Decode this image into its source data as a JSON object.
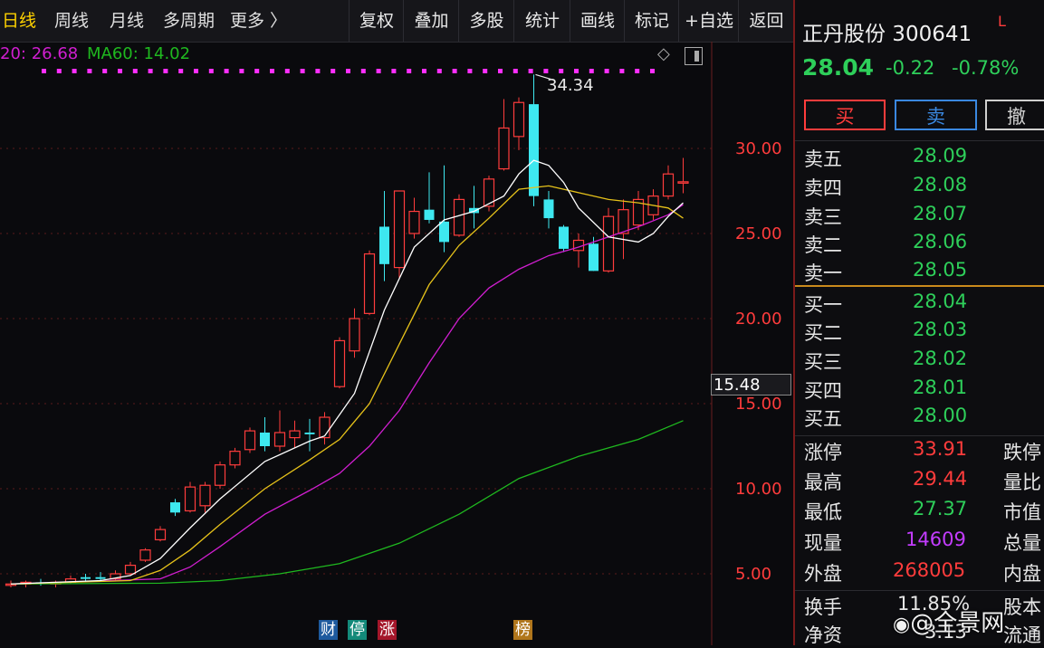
{
  "toolbar": {
    "tabs": [
      {
        "label": "日线",
        "active": true
      },
      {
        "label": "周线"
      },
      {
        "label": "月线"
      },
      {
        "label": "多周期"
      },
      {
        "label": "更多 〉"
      }
    ],
    "buttons": [
      "复权",
      "叠加",
      "多股",
      "统计",
      "画线",
      "标记",
      "+自选",
      "返回"
    ]
  },
  "ma_labels": {
    "ma20": "20: 26.68",
    "ma60": "MA60: 14.02"
  },
  "peak_label": "34.34",
  "price_axis": {
    "ticks": [
      "30.00",
      "25.00",
      "20.00",
      "15.00",
      "10.00",
      "5.00"
    ],
    "current_box": "15.48"
  },
  "event_markers": [
    "财",
    "停",
    "涨",
    "榜"
  ],
  "stock": {
    "name": "正丹股份 300641",
    "flag": "L",
    "price": "28.04",
    "change": "-0.22",
    "change_pct": "-0.78%"
  },
  "trade_buttons": {
    "buy": "买",
    "sell": "卖",
    "cancel": "撤"
  },
  "asks": [
    {
      "label": "卖五",
      "price": "28.09"
    },
    {
      "label": "卖四",
      "price": "28.08"
    },
    {
      "label": "卖三",
      "price": "28.07"
    },
    {
      "label": "卖二",
      "price": "28.06"
    },
    {
      "label": "卖一",
      "price": "28.05"
    }
  ],
  "bids": [
    {
      "label": "买一",
      "price": "28.04"
    },
    {
      "label": "买二",
      "price": "28.03"
    },
    {
      "label": "买三",
      "price": "28.02"
    },
    {
      "label": "买四",
      "price": "28.01"
    },
    {
      "label": "买五",
      "price": "28.00"
    }
  ],
  "stats": [
    {
      "label": "涨停",
      "value": "33.91",
      "label2": "跌停"
    },
    {
      "label": "最高",
      "value": "29.44",
      "label2": "量比"
    },
    {
      "label": "最低",
      "value": "27.37",
      "label2": "市值"
    },
    {
      "label": "现量",
      "value": "14609",
      "label2": "总量"
    },
    {
      "label": "外盘",
      "value": "268005",
      "label2": "内盘"
    }
  ],
  "extra": [
    {
      "label": "换手",
      "value": "11.85%",
      "label2": "股本"
    },
    {
      "label": "净资",
      "value": "3.13",
      "label2": "流通"
    }
  ],
  "watermark": "@全景网",
  "colors": {
    "up": "#ff3c3c",
    "down": "#3ee8f0",
    "ma5": "#ffffff",
    "ma10": "#e6c21a",
    "ma20": "#d01ed0",
    "ma60": "#1fb81f"
  },
  "chart_data": {
    "type": "candlestick",
    "ylim": [
      3,
      36
    ],
    "candles": [
      {
        "o": 4.4,
        "h": 4.6,
        "l": 4.2,
        "c": 4.4
      },
      {
        "o": 4.4,
        "h": 4.6,
        "l": 4.2,
        "c": 4.5
      },
      {
        "o": 4.5,
        "h": 4.7,
        "l": 4.3,
        "c": 4.4
      },
      {
        "o": 4.4,
        "h": 4.6,
        "l": 4.2,
        "c": 4.5
      },
      {
        "o": 4.5,
        "h": 4.9,
        "l": 4.4,
        "c": 4.7
      },
      {
        "o": 4.8,
        "h": 5.0,
        "l": 4.6,
        "c": 4.7
      },
      {
        "o": 4.8,
        "h": 5.1,
        "l": 4.6,
        "c": 4.7
      },
      {
        "o": 4.7,
        "h": 5.2,
        "l": 4.6,
        "c": 5.0
      },
      {
        "o": 5.0,
        "h": 5.7,
        "l": 4.9,
        "c": 5.5
      },
      {
        "o": 5.8,
        "h": 6.5,
        "l": 5.7,
        "c": 6.4
      },
      {
        "o": 7.0,
        "h": 7.8,
        "l": 6.9,
        "c": 7.6
      },
      {
        "o": 9.2,
        "h": 9.4,
        "l": 8.4,
        "c": 8.6
      },
      {
        "o": 8.7,
        "h": 10.4,
        "l": 8.6,
        "c": 10.1
      },
      {
        "o": 9.0,
        "h": 10.4,
        "l": 8.6,
        "c": 10.2
      },
      {
        "o": 10.2,
        "h": 11.6,
        "l": 10.0,
        "c": 11.4
      },
      {
        "o": 11.4,
        "h": 12.4,
        "l": 11.2,
        "c": 12.2
      },
      {
        "o": 12.3,
        "h": 13.6,
        "l": 12.1,
        "c": 13.4
      },
      {
        "o": 13.3,
        "h": 14.2,
        "l": 12.2,
        "c": 12.5
      },
      {
        "o": 12.5,
        "h": 14.6,
        "l": 12.2,
        "c": 13.3
      },
      {
        "o": 13.0,
        "h": 14.0,
        "l": 12.4,
        "c": 13.4
      },
      {
        "o": 13.3,
        "h": 14.1,
        "l": 12.2,
        "c": 13.2
      },
      {
        "o": 13.0,
        "h": 14.5,
        "l": 12.6,
        "c": 14.2
      },
      {
        "o": 16.0,
        "h": 18.9,
        "l": 15.9,
        "c": 18.7
      },
      {
        "o": 18.1,
        "h": 20.6,
        "l": 17.7,
        "c": 20.0
      },
      {
        "o": 20.3,
        "h": 24.0,
        "l": 20.2,
        "c": 23.8
      },
      {
        "o": 25.4,
        "h": 27.5,
        "l": 22.2,
        "c": 23.2
      },
      {
        "o": 23.0,
        "h": 27.5,
        "l": 22.4,
        "c": 27.5
      },
      {
        "o": 25.0,
        "h": 27.1,
        "l": 24.7,
        "c": 26.3
      },
      {
        "o": 26.4,
        "h": 28.6,
        "l": 25.6,
        "c": 25.8
      },
      {
        "o": 25.7,
        "h": 29.0,
        "l": 23.9,
        "c": 24.5
      },
      {
        "o": 24.9,
        "h": 27.3,
        "l": 24.8,
        "c": 27.0
      },
      {
        "o": 26.5,
        "h": 27.8,
        "l": 25.3,
        "c": 26.2
      },
      {
        "o": 26.6,
        "h": 28.4,
        "l": 26.3,
        "c": 28.2
      },
      {
        "o": 28.8,
        "h": 32.9,
        "l": 28.7,
        "c": 31.2
      },
      {
        "o": 30.7,
        "h": 33.0,
        "l": 29.9,
        "c": 32.7
      },
      {
        "o": 32.6,
        "h": 34.34,
        "l": 26.6,
        "c": 27.2
      },
      {
        "o": 27.0,
        "h": 27.5,
        "l": 25.3,
        "c": 25.9
      },
      {
        "o": 25.4,
        "h": 25.5,
        "l": 23.9,
        "c": 24.1
      },
      {
        "o": 24.0,
        "h": 25.0,
        "l": 23.0,
        "c": 24.6
      },
      {
        "o": 24.4,
        "h": 24.8,
        "l": 22.8,
        "c": 22.8
      },
      {
        "o": 22.8,
        "h": 26.5,
        "l": 22.7,
        "c": 26.0
      },
      {
        "o": 25.0,
        "h": 27.0,
        "l": 23.5,
        "c": 26.4
      },
      {
        "o": 25.5,
        "h": 27.5,
        "l": 25.2,
        "c": 27.0
      },
      {
        "o": 26.1,
        "h": 27.6,
        "l": 25.8,
        "c": 27.2
      },
      {
        "o": 27.2,
        "h": 29.0,
        "l": 27.0,
        "c": 28.5
      },
      {
        "o": 28.0,
        "h": 29.44,
        "l": 27.37,
        "c": 28.04
      }
    ],
    "ma5": [
      [
        0,
        4.4
      ],
      [
        6,
        4.6
      ],
      [
        8,
        4.9
      ],
      [
        10,
        5.9
      ],
      [
        12,
        7.7
      ],
      [
        14,
        9.4
      ],
      [
        17,
        11.6
      ],
      [
        20,
        12.8
      ],
      [
        21,
        13.1
      ],
      [
        23,
        15.6
      ],
      [
        25,
        20.5
      ],
      [
        27,
        24.2
      ],
      [
        29,
        25.8
      ],
      [
        31,
        26.3
      ],
      [
        33,
        27.2
      ],
      [
        34,
        28.5
      ],
      [
        35,
        29.3
      ],
      [
        36,
        29.0
      ],
      [
        37,
        28.0
      ],
      [
        38,
        26.5
      ],
      [
        40,
        24.8
      ],
      [
        42,
        24.5
      ],
      [
        43,
        25.0
      ],
      [
        44,
        26.0
      ],
      [
        45,
        26.8
      ]
    ],
    "ma10": [
      [
        0,
        4.4
      ],
      [
        8,
        4.6
      ],
      [
        10,
        5.2
      ],
      [
        12,
        6.4
      ],
      [
        14,
        7.9
      ],
      [
        17,
        10.0
      ],
      [
        20,
        11.7
      ],
      [
        22,
        12.9
      ],
      [
        24,
        15.0
      ],
      [
        26,
        18.5
      ],
      [
        28,
        22.0
      ],
      [
        30,
        24.3
      ],
      [
        32,
        25.9
      ],
      [
        34,
        27.6
      ],
      [
        36,
        27.8
      ],
      [
        38,
        27.4
      ],
      [
        40,
        27.0
      ],
      [
        42,
        26.8
      ],
      [
        44,
        26.5
      ],
      [
        45,
        25.9
      ]
    ],
    "ma20": [
      [
        0,
        4.4
      ],
      [
        10,
        4.7
      ],
      [
        12,
        5.4
      ],
      [
        14,
        6.6
      ],
      [
        17,
        8.5
      ],
      [
        20,
        9.9
      ],
      [
        22,
        10.9
      ],
      [
        24,
        12.5
      ],
      [
        26,
        14.6
      ],
      [
        28,
        17.4
      ],
      [
        30,
        20.0
      ],
      [
        32,
        21.8
      ],
      [
        34,
        22.9
      ],
      [
        36,
        23.7
      ],
      [
        38,
        24.2
      ],
      [
        40,
        24.8
      ],
      [
        42,
        25.4
      ],
      [
        44,
        26.1
      ],
      [
        45,
        26.7
      ]
    ],
    "ma60": [
      [
        0,
        4.4
      ],
      [
        10,
        4.45
      ],
      [
        14,
        4.6
      ],
      [
        18,
        5.0
      ],
      [
        22,
        5.6
      ],
      [
        26,
        6.8
      ],
      [
        30,
        8.5
      ],
      [
        34,
        10.6
      ],
      [
        38,
        11.9
      ],
      [
        42,
        12.9
      ],
      [
        45,
        14.0
      ]
    ]
  }
}
